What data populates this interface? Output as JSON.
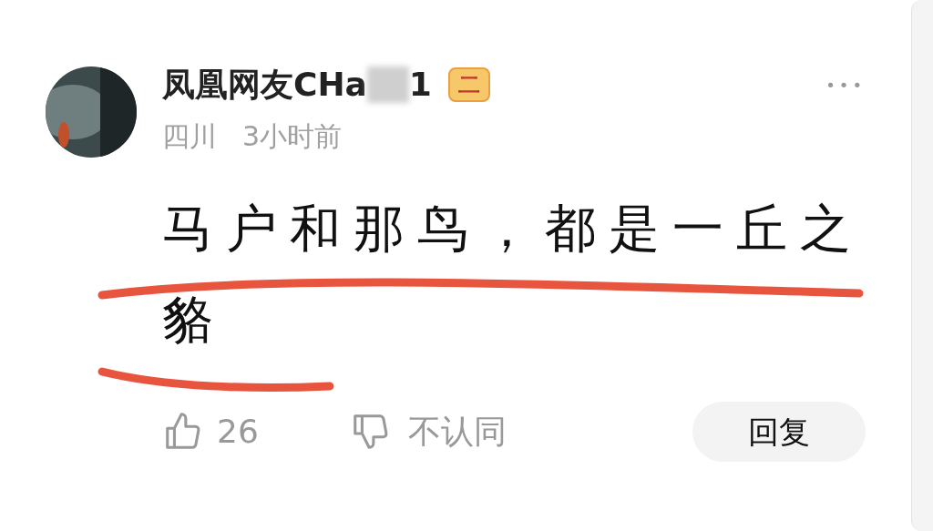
{
  "author": {
    "name_start": "凤凰网友CHa",
    "name_end": "1",
    "level_badge": "二"
  },
  "meta": {
    "location": "四川",
    "time": "3小时前"
  },
  "more": "•••",
  "comment": {
    "lines": [
      "马户和那鸟，都是一丘之",
      "貉"
    ]
  },
  "actions": {
    "likes": "26",
    "dislike": "不认同",
    "reply": "回复"
  }
}
